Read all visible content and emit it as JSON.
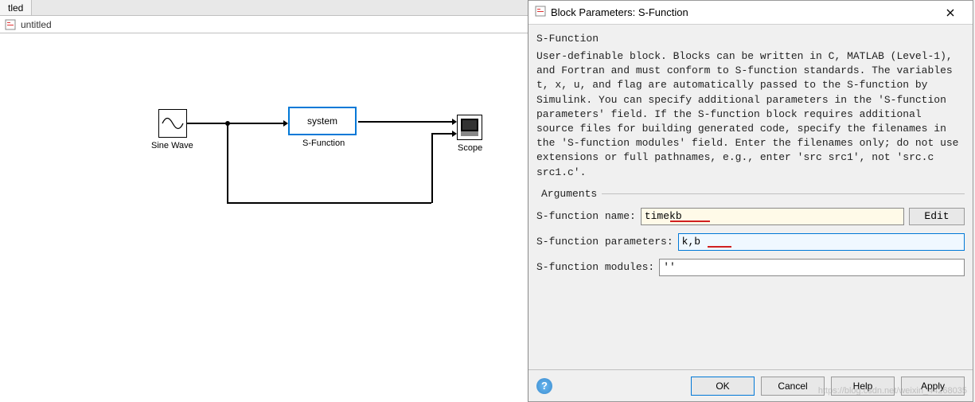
{
  "tabs": {
    "tab1": "tled"
  },
  "model": {
    "name": "untitled"
  },
  "blocks": {
    "sine_label": "Sine Wave",
    "sfunc_text": "system",
    "sfunc_label": "S-Function",
    "scope_label": "Scope"
  },
  "dialog": {
    "title": "Block Parameters: S-Function",
    "section": "S-Function",
    "description": "User-definable block.  Blocks can be written in C, MATLAB (Level-1), and Fortran and must conform to S-function standards. The variables t, x, u, and flag are automatically passed to the S-function by Simulink.  You can specify additional parameters in the 'S-function parameters' field. If the S-function block requires additional source files for building generated code, specify the filenames in the 'S-function modules' field. Enter the filenames only; do not use extensions or full pathnames, e.g., enter 'src src1', not 'src.c src1.c'.",
    "arguments_label": "Arguments",
    "fields": {
      "name_label": "S-function name:",
      "name_value": "timekb",
      "edit_label": "Edit",
      "params_label": "S-function parameters:",
      "params_value": "k,b",
      "modules_label": "S-function modules:",
      "modules_value": "''"
    },
    "buttons": {
      "ok": "OK",
      "cancel": "Cancel",
      "help": "Help",
      "apply": "Apply"
    }
  },
  "watermark": "https://blog.csdn.net/weixin_44268035"
}
